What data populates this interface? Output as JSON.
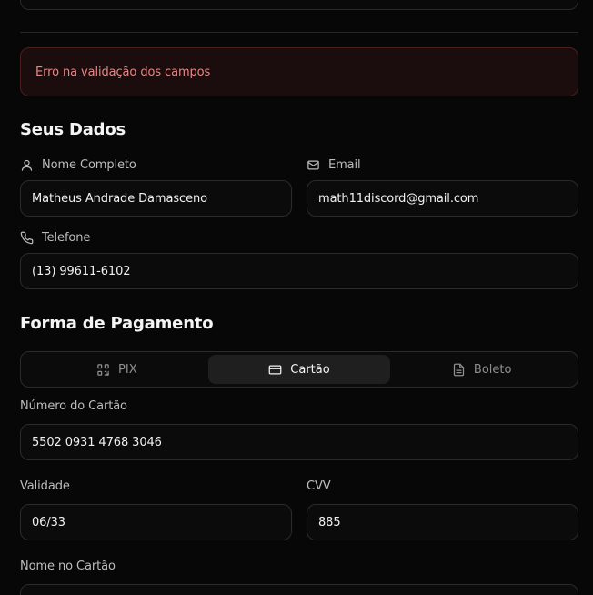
{
  "alert": {
    "message": "Erro na validação dos campos"
  },
  "personal": {
    "title": "Seus Dados",
    "name": {
      "label": "Nome Completo",
      "value": "Matheus Andrade Damasceno"
    },
    "email": {
      "label": "Email",
      "value": "math11discord@gmail.com"
    },
    "phone": {
      "label": "Telefone",
      "value": "(13) 99611-6102"
    }
  },
  "payment": {
    "title": "Forma de Pagamento",
    "tabs": [
      {
        "label": "PIX",
        "icon": "qr-code-icon",
        "active": false
      },
      {
        "label": "Cartão",
        "icon": "credit-card-icon",
        "active": true
      },
      {
        "label": "Boleto",
        "icon": "file-text-icon",
        "active": false
      }
    ],
    "card_number": {
      "label": "Número do Cartão",
      "value": "5502 0931 4768 3046"
    },
    "expiry": {
      "label": "Validade",
      "value": "06/33"
    },
    "cvv": {
      "label": "CVV",
      "value": "885"
    },
    "card_name": {
      "label": "Nome no Cartão"
    }
  }
}
